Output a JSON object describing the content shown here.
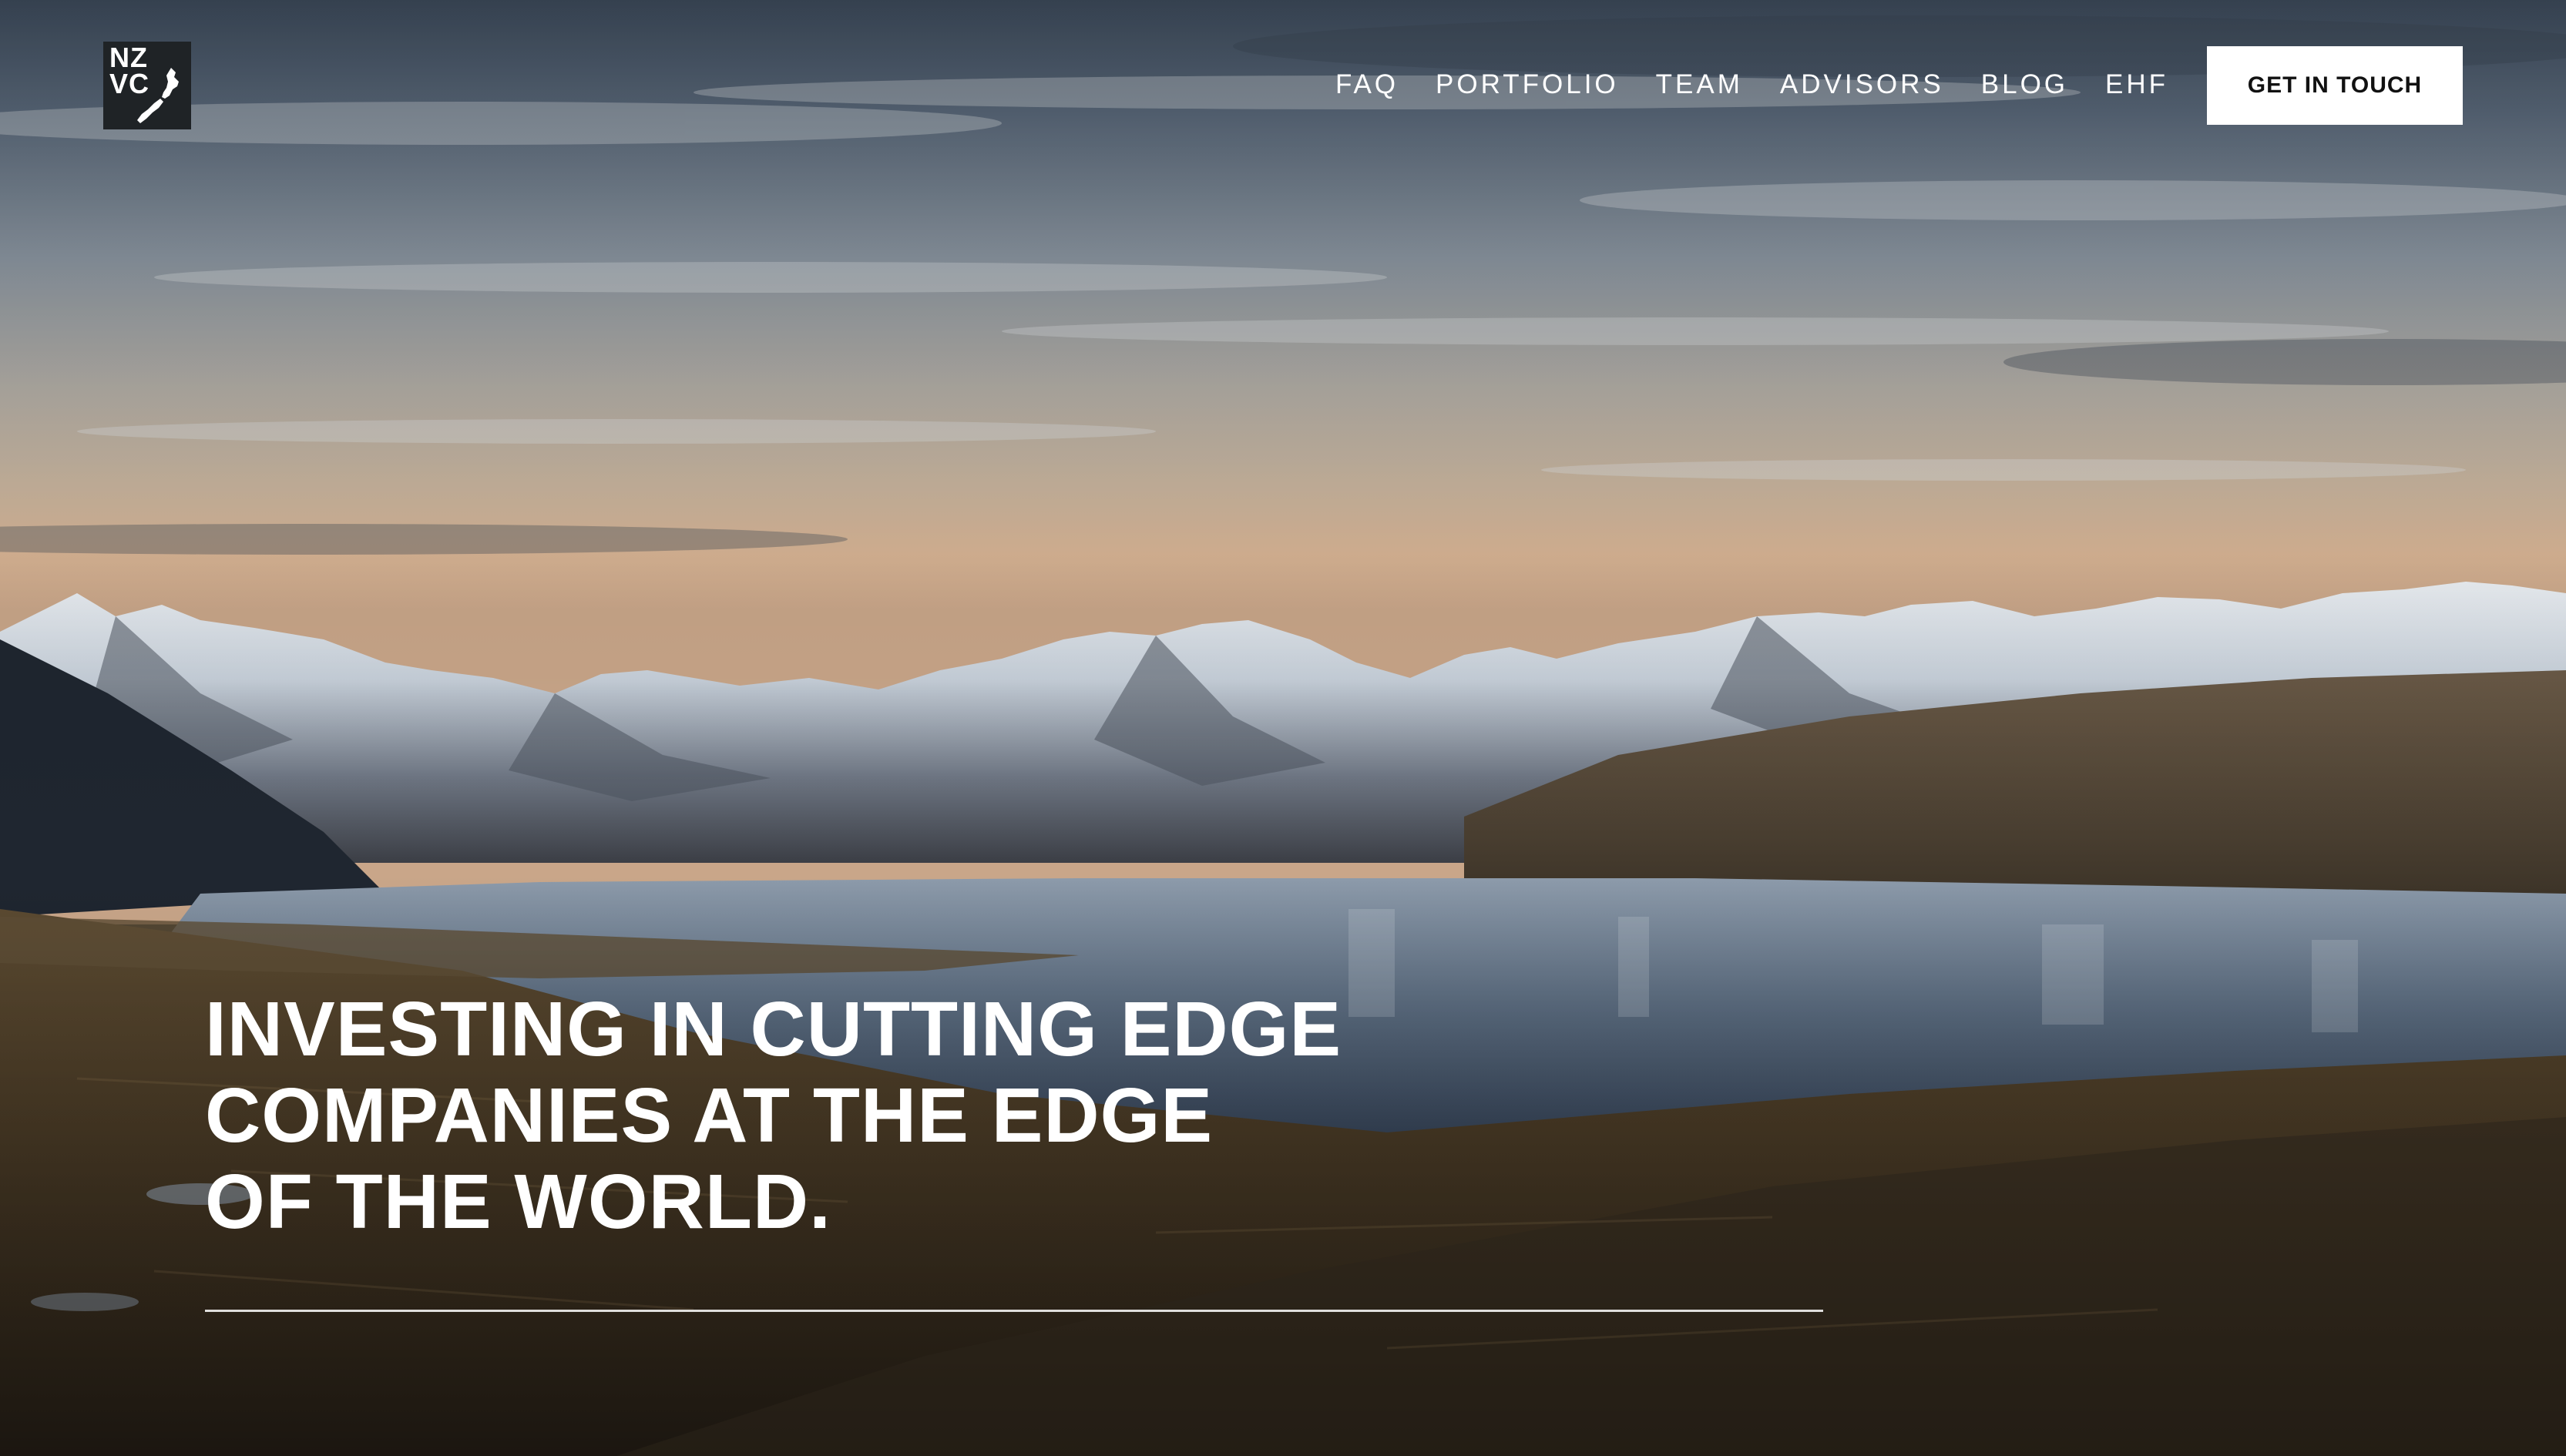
{
  "brand": {
    "logo_text": "NZ\nVC"
  },
  "nav": {
    "items": [
      {
        "label": "FAQ"
      },
      {
        "label": "PORTFOLIO"
      },
      {
        "label": "TEAM"
      },
      {
        "label": "ADVISORS"
      },
      {
        "label": "BLOG"
      },
      {
        "label": "EHF"
      }
    ],
    "cta_label": "GET IN TOUCH"
  },
  "hero": {
    "headline_lines": [
      "INVESTING IN CUTTING EDGE",
      "COMPANIES AT THE EDGE",
      "OF THE WORLD."
    ],
    "background_image": "mountain-lake-landscape"
  },
  "colors": {
    "cta_background": "#ffffff",
    "text": "#ffffff",
    "logo_background": "#1f2326"
  }
}
